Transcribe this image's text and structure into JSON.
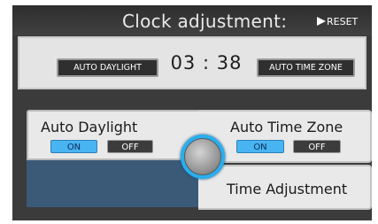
{
  "header": {
    "title": "Clock adjustment:",
    "reset_label": "RESET",
    "reset_icon": "play-arrow-icon"
  },
  "info": {
    "auto_daylight_tag": "AUTO DAYLIGHT",
    "time": "03 : 38",
    "auto_time_zone_tag": "AUTO TIME ZONE"
  },
  "auto_daylight": {
    "label": "Auto Daylight",
    "on_label": "ON",
    "off_label": "OFF",
    "selected": "ON"
  },
  "auto_time_zone": {
    "label": "Auto Time Zone",
    "on_label": "ON",
    "off_label": "OFF",
    "selected": "ON"
  },
  "time_adjustment": {
    "label": "Time Adjustment"
  },
  "knob": {
    "icon": "selector-knob-icon"
  },
  "colors": {
    "background": "#3b3b3b",
    "panel": "#e9e9e9",
    "active_toggle": "#49b4f2",
    "inactive_toggle": "#3c3c3c",
    "highlight": "#3a5a78",
    "knob_ring": "#29aef0"
  }
}
